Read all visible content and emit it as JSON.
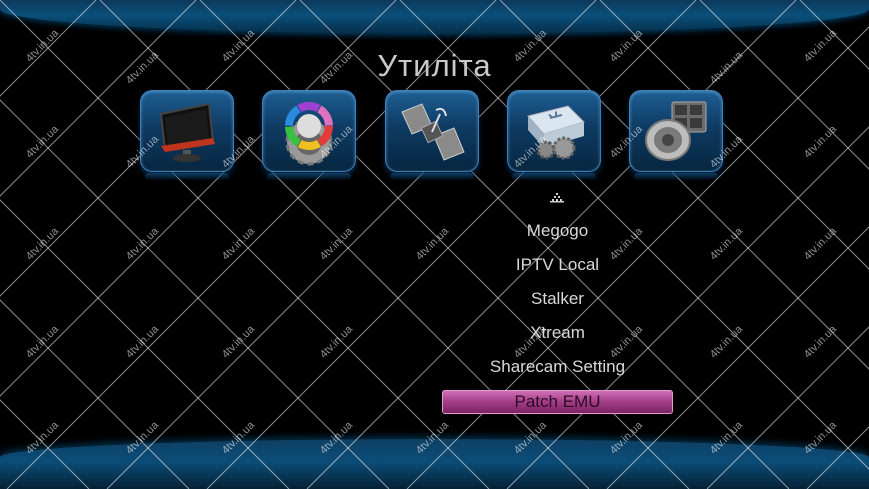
{
  "screen": {
    "title": "Утиліта"
  },
  "icons": [
    {
      "name": "monitor-icon"
    },
    {
      "name": "color-settings-icon"
    },
    {
      "name": "satellite-icon"
    },
    {
      "name": "usb-tools-icon"
    },
    {
      "name": "media-speaker-icon"
    }
  ],
  "menu": {
    "items": [
      {
        "label": "Megogo",
        "selected": false
      },
      {
        "label": "IPTV Local",
        "selected": false
      },
      {
        "label": "Stalker",
        "selected": false
      },
      {
        "label": "Xtream",
        "selected": false
      },
      {
        "label": "Sharecam Setting",
        "selected": false
      },
      {
        "label": "Patch EMU",
        "selected": true
      }
    ]
  },
  "watermark": {
    "text": "4tv.in.ua"
  },
  "colors": {
    "accent_blue": "#0a4f7a",
    "selection_magenta": "#a33c88",
    "background": "#000000"
  }
}
